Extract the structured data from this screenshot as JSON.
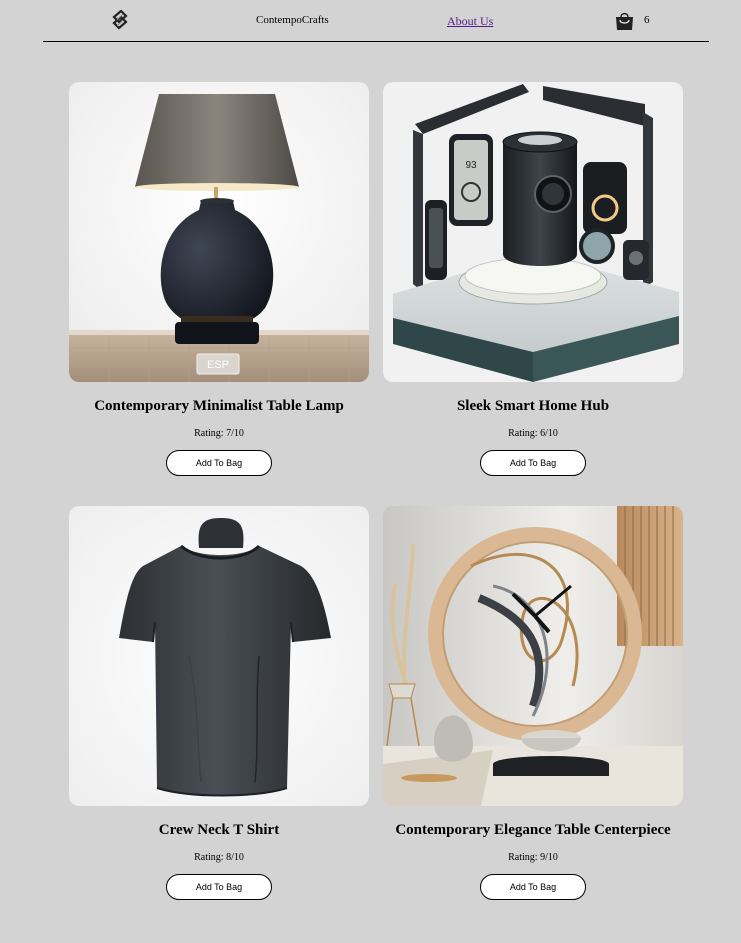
{
  "header": {
    "brand": "ContempoCrafts",
    "about_link": "About Us",
    "bag_count": "6"
  },
  "products": [
    {
      "title": "Contemporary Minimalist Table Lamp",
      "rating": "Rating: 7/10",
      "button": "Add To Bag",
      "image_label": "ESP"
    },
    {
      "title": "Sleek Smart Home Hub",
      "rating": "Rating: 6/10",
      "button": "Add To Bag",
      "image_label": "93"
    },
    {
      "title": "Crew Neck T Shirt",
      "rating": "Rating: 8/10",
      "button": "Add To Bag"
    },
    {
      "title": "Contemporary Elegance Table Centerpiece",
      "rating": "Rating: 9/10",
      "button": "Add To Bag"
    }
  ],
  "colors": {
    "page_background": "#d3d3d3",
    "link": "#551a8b",
    "button_background": "#ffffff"
  },
  "icons": {
    "logo": "knot-logo-icon",
    "bag": "shopping-bag-icon"
  }
}
